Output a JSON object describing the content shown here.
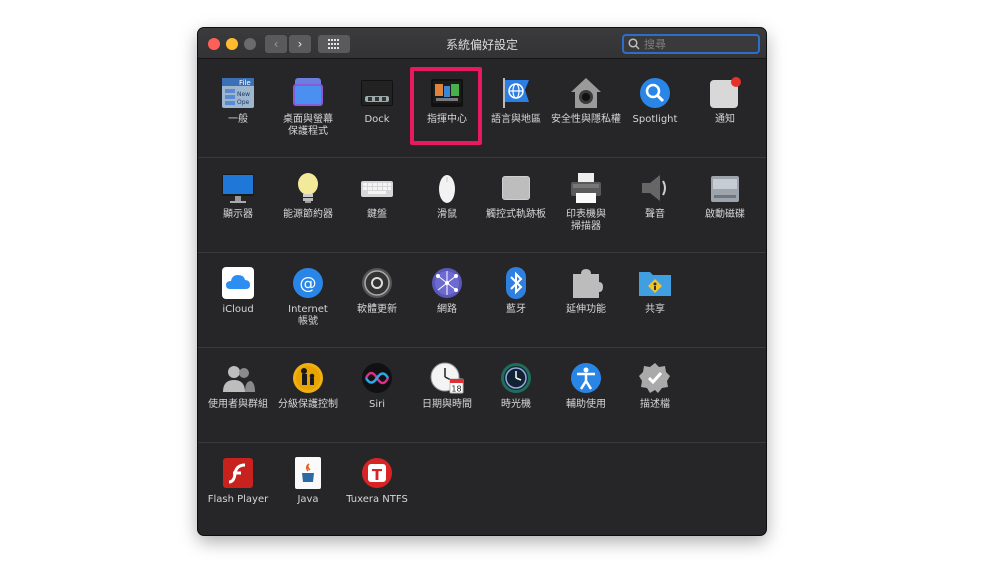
{
  "window": {
    "title": "系統偏好設定"
  },
  "toolbar": {
    "back": "‹",
    "forward": "›"
  },
  "search": {
    "placeholder": "搜尋"
  },
  "rows": [
    [
      "一般",
      "桌面與螢幕\n保護程式",
      "Dock",
      "指揮中心",
      "語言與地區",
      "安全性與隱私權",
      "Spotlight",
      "通知"
    ],
    [
      "顯示器",
      "能源節約器",
      "鍵盤",
      "滑鼠",
      "觸控式軌跡板",
      "印表機與\n掃描器",
      "聲音",
      "啟動磁碟"
    ],
    [
      "iCloud",
      "Internet\n帳號",
      "軟體更新",
      "網路",
      "藍牙",
      "延伸功能",
      "共享"
    ],
    [
      "使用者與群組",
      "分級保護控制",
      "Siri",
      "日期與時間",
      "時光機",
      "輔助使用",
      "描述檔"
    ],
    [
      "Flash Player",
      "Java",
      "Tuxera NTFS"
    ]
  ],
  "icons": [
    [
      "general-icon",
      "desktop-screensaver-icon",
      "dock-icon",
      "mission-control-icon",
      "language-region-icon",
      "security-privacy-icon",
      "spotlight-icon",
      "notifications-icon"
    ],
    [
      "displays-icon",
      "energy-saver-icon",
      "keyboard-icon",
      "mouse-icon",
      "trackpad-icon",
      "printers-scanners-icon",
      "sound-icon",
      "startup-disk-icon"
    ],
    [
      "icloud-icon",
      "internet-accounts-icon",
      "software-update-icon",
      "network-icon",
      "bluetooth-icon",
      "extensions-icon",
      "sharing-icon"
    ],
    [
      "users-groups-icon",
      "parental-controls-icon",
      "siri-icon",
      "date-time-icon",
      "time-machine-icon",
      "accessibility-icon",
      "profiles-icon"
    ],
    [
      "flash-player-icon",
      "java-icon",
      "tuxera-ntfs-icon"
    ]
  ],
  "highlight": {
    "color": "#e8195c",
    "target": "指揮中心"
  },
  "icon_text": {
    "general": "File",
    "calendar": "18"
  }
}
